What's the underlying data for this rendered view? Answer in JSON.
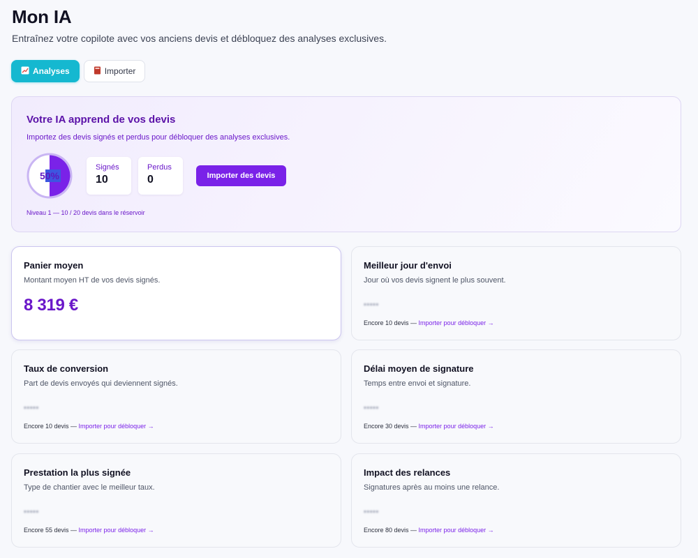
{
  "header": {
    "title": "Mon IA",
    "subtitle": "Entraînez votre copilote avec vos anciens devis et débloquez des analyses exclusives."
  },
  "tabs": [
    {
      "label": "Analyses",
      "icon": "chart-up-icon",
      "active": true
    },
    {
      "label": "Importer",
      "icon": "book-icon",
      "active": false
    }
  ],
  "hero": {
    "title": "Votre IA apprend de vos devis",
    "text": "Importez des devis signés et perdus pour débloquer des analyses exclusives.",
    "progress_label": "50%",
    "progress_fraction": 0.5,
    "stats": {
      "signes_label": "Signés",
      "signes_value": "10",
      "perdus_label": "Perdus",
      "perdus_value": "0"
    },
    "import_button": "Importer des devis",
    "level_text": "Niveau 1 — 10 / 20 devis dans le réservoir"
  },
  "cards": [
    {
      "title": "Panier moyen",
      "desc": "Montant moyen HT de vos devis signés.",
      "value": "8 319 €",
      "locked": false
    },
    {
      "title": "Meilleur jour d'envoi",
      "desc": "Jour où vos devis signent le plus souvent.",
      "placeholder": "•••••",
      "footer_prefix": "Encore 10 devis — ",
      "footer_link": "Importer pour débloquer →",
      "locked": true
    },
    {
      "title": "Taux de conversion",
      "desc": "Part de devis envoyés qui deviennent signés.",
      "placeholder": "•••••",
      "footer_prefix": "Encore 10 devis — ",
      "footer_link": "Importer pour débloquer →",
      "locked": true
    },
    {
      "title": "Délai moyen de signature",
      "desc": "Temps entre envoi et signature.",
      "placeholder": "•••••",
      "footer_prefix": "Encore 30 devis — ",
      "footer_link": "Importer pour débloquer →",
      "locked": true
    },
    {
      "title": "Prestation la plus signée",
      "desc": "Type de chantier avec le meilleur taux.",
      "placeholder": "•••••",
      "footer_prefix": "Encore 55 devis — ",
      "footer_link": "Importer pour débloquer →",
      "locked": true
    },
    {
      "title": "Impact des relances",
      "desc": "Signatures après au moins une relance.",
      "placeholder": "•••••",
      "footer_prefix": "Encore 80 devis — ",
      "footer_link": "Importer pour débloquer →",
      "locked": true
    }
  ],
  "colors": {
    "accent_purple": "#7a22e8",
    "accent_cyan": "#15b8d0",
    "title_purple": "#5b12a8"
  }
}
